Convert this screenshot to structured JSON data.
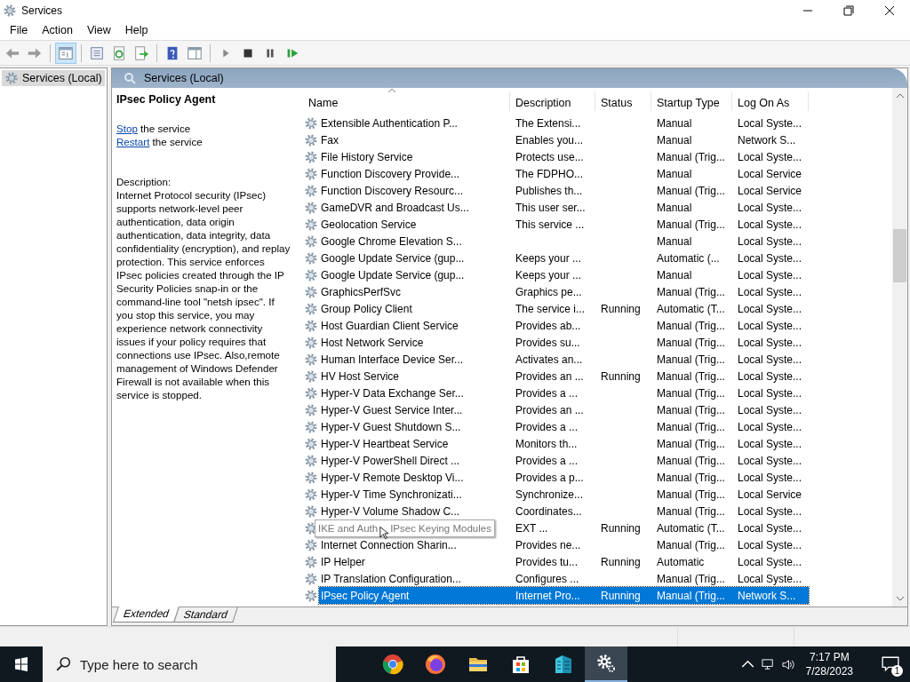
{
  "window": {
    "title": "Services"
  },
  "menu": [
    "File",
    "Action",
    "View",
    "Help"
  ],
  "tree": {
    "items": [
      {
        "label": "Services (Local)",
        "selected": true
      }
    ]
  },
  "panel_header": {
    "title": "Services (Local)"
  },
  "details": {
    "title": "IPsec Policy Agent",
    "actions": [
      {
        "link": "Stop",
        "text": " the service"
      },
      {
        "link": "Restart",
        "text": " the service"
      }
    ],
    "description_label": "Description:",
    "description": "Internet Protocol security (IPsec) supports network-level peer authentication, data origin authentication, data integrity, data confidentiality (encryption), and replay protection.  This service enforces IPsec policies created through the IP Security Policies snap-in or the command-line tool \"netsh ipsec\".  If you stop this service, you may experience network connectivity issues if your policy requires that connections use IPsec.  Also,remote management of Windows Defender Firewall is not available when this service is stopped."
  },
  "table": {
    "columns": [
      {
        "label": "Name",
        "sorted": true
      },
      {
        "label": "Description",
        "sorted": false
      },
      {
        "label": "Status",
        "sorted": false
      },
      {
        "label": "Startup Type",
        "sorted": false
      },
      {
        "label": "Log On As",
        "sorted": false
      }
    ],
    "rows": [
      {
        "cells": [
          "Extensible Authentication P...",
          "The Extensi...",
          "",
          "Manual",
          "Local Syste..."
        ],
        "selected": false
      },
      {
        "cells": [
          "Fax",
          "Enables you...",
          "",
          "Manual",
          "Network S..."
        ],
        "selected": false
      },
      {
        "cells": [
          "File History Service",
          "Protects use...",
          "",
          "Manual (Trig...",
          "Local Syste..."
        ],
        "selected": false
      },
      {
        "cells": [
          "Function Discovery Provide...",
          "The FDPHO...",
          "",
          "Manual",
          "Local Service"
        ],
        "selected": false
      },
      {
        "cells": [
          "Function Discovery Resourc...",
          "Publishes th...",
          "",
          "Manual (Trig...",
          "Local Service"
        ],
        "selected": false
      },
      {
        "cells": [
          "GameDVR and Broadcast Us...",
          "This user ser...",
          "",
          "Manual",
          "Local Syste..."
        ],
        "selected": false
      },
      {
        "cells": [
          "Geolocation Service",
          "This service ...",
          "",
          "Manual (Trig...",
          "Local Syste..."
        ],
        "selected": false
      },
      {
        "cells": [
          "Google Chrome Elevation S...",
          "",
          "",
          "Manual",
          "Local Syste..."
        ],
        "selected": false
      },
      {
        "cells": [
          "Google Update Service (gup...",
          "Keeps your ...",
          "",
          "Automatic (...",
          "Local Syste..."
        ],
        "selected": false
      },
      {
        "cells": [
          "Google Update Service (gup...",
          "Keeps your ...",
          "",
          "Manual",
          "Local Syste..."
        ],
        "selected": false
      },
      {
        "cells": [
          "GraphicsPerfSvc",
          "Graphics pe...",
          "",
          "Manual (Trig...",
          "Local Syste..."
        ],
        "selected": false
      },
      {
        "cells": [
          "Group Policy Client",
          "The service i...",
          "Running",
          "Automatic (T...",
          "Local Syste..."
        ],
        "selected": false
      },
      {
        "cells": [
          "Host Guardian Client Service",
          "Provides ab...",
          "",
          "Manual (Trig...",
          "Local Syste..."
        ],
        "selected": false
      },
      {
        "cells": [
          "Host Network Service",
          "Provides su...",
          "",
          "Manual (Trig...",
          "Local Syste..."
        ],
        "selected": false
      },
      {
        "cells": [
          "Human Interface Device Ser...",
          "Activates an...",
          "",
          "Manual (Trig...",
          "Local Syste..."
        ],
        "selected": false
      },
      {
        "cells": [
          "HV Host Service",
          "Provides an ...",
          "Running",
          "Manual (Trig...",
          "Local Syste..."
        ],
        "selected": false
      },
      {
        "cells": [
          "Hyper-V Data Exchange Ser...",
          "Provides a ...",
          "",
          "Manual (Trig...",
          "Local Syste..."
        ],
        "selected": false
      },
      {
        "cells": [
          "Hyper-V Guest Service Inter...",
          "Provides an ...",
          "",
          "Manual (Trig...",
          "Local Syste..."
        ],
        "selected": false
      },
      {
        "cells": [
          "Hyper-V Guest Shutdown S...",
          "Provides a ...",
          "",
          "Manual (Trig...",
          "Local Syste..."
        ],
        "selected": false
      },
      {
        "cells": [
          "Hyper-V Heartbeat Service",
          "Monitors th...",
          "",
          "Manual (Trig...",
          "Local Syste..."
        ],
        "selected": false
      },
      {
        "cells": [
          "Hyper-V PowerShell Direct ...",
          "Provides a ...",
          "",
          "Manual (Trig...",
          "Local Syste..."
        ],
        "selected": false
      },
      {
        "cells": [
          "Hyper-V Remote Desktop Vi...",
          "Provides a p...",
          "",
          "Manual (Trig...",
          "Local Syste..."
        ],
        "selected": false
      },
      {
        "cells": [
          "Hyper-V Time Synchronizati...",
          "Synchronize...",
          "",
          "Manual (Trig...",
          "Local Service"
        ],
        "selected": false
      },
      {
        "cells": [
          "Hyper-V Volume Shadow C...",
          "Coordinates...",
          "",
          "Manual (Trig...",
          "Local Syste..."
        ],
        "selected": false
      },
      {
        "cells": [
          "",
          "EXT ...",
          "Running",
          "Automatic (T...",
          "Local Syste..."
        ],
        "selected": false,
        "tooltip": [
          "IKE and Auth",
          "IPsec Keying Modules"
        ]
      },
      {
        "cells": [
          "Internet Connection Sharin...",
          "Provides ne...",
          "",
          "Manual (Trig...",
          "Local Syste..."
        ],
        "selected": false
      },
      {
        "cells": [
          "IP Helper",
          "Provides tu...",
          "Running",
          "Automatic",
          "Local Syste..."
        ],
        "selected": false
      },
      {
        "cells": [
          "IP Translation Configuration...",
          "Configures ...",
          "",
          "Manual (Trig...",
          "Local Syste..."
        ],
        "selected": false
      },
      {
        "cells": [
          "IPsec Policy Agent",
          "Internet Pro...",
          "Running",
          "Manual (Trig...",
          "Network S..."
        ],
        "selected": true
      }
    ]
  },
  "view_tabs": [
    {
      "label": "Extended",
      "selected": true
    },
    {
      "label": "Standard",
      "selected": false
    }
  ],
  "taskbar": {
    "search": {
      "placeholder": "Type here to search"
    },
    "apps": [
      {
        "kind": "chrome",
        "selected": false
      },
      {
        "kind": "firefox",
        "selected": false
      },
      {
        "kind": "folder",
        "selected": false
      },
      {
        "kind": "store",
        "selected": false
      },
      {
        "kind": "building",
        "selected": false
      },
      {
        "kind": "gear",
        "selected": true
      }
    ],
    "time": "7:17 PM",
    "date": "7/28/2023",
    "notifications": "1"
  }
}
